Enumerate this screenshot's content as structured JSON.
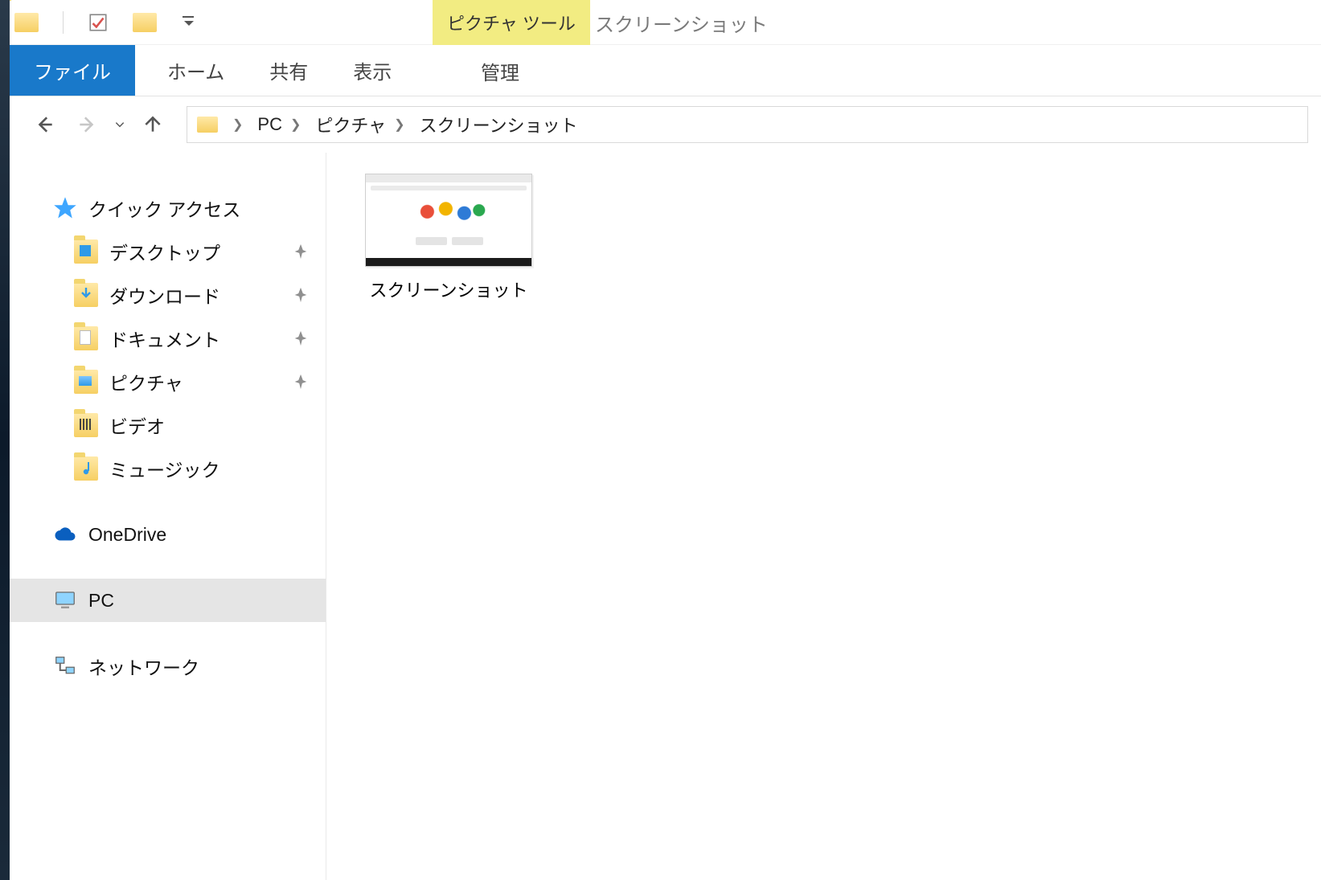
{
  "window": {
    "context_tools_label": "ピクチャ ツール",
    "title": "スクリーンショット"
  },
  "ribbon": {
    "file": "ファイル",
    "home": "ホーム",
    "share": "共有",
    "view": "表示",
    "manage": "管理"
  },
  "breadcrumb": {
    "root": "PC",
    "level1": "ピクチャ",
    "level2": "スクリーンショット"
  },
  "sidebar": {
    "quick_access": "クイック アクセス",
    "desktop": "デスクトップ",
    "downloads": "ダウンロード",
    "documents": "ドキュメント",
    "pictures": "ピクチャ",
    "videos": "ビデオ",
    "music": "ミュージック",
    "onedrive": "OneDrive",
    "pc": "PC",
    "network": "ネットワーク"
  },
  "content": {
    "items": [
      {
        "name": "スクリーンショット"
      }
    ]
  },
  "colors": {
    "accent": "#1979ca",
    "context_tab": "#f2ec82"
  }
}
